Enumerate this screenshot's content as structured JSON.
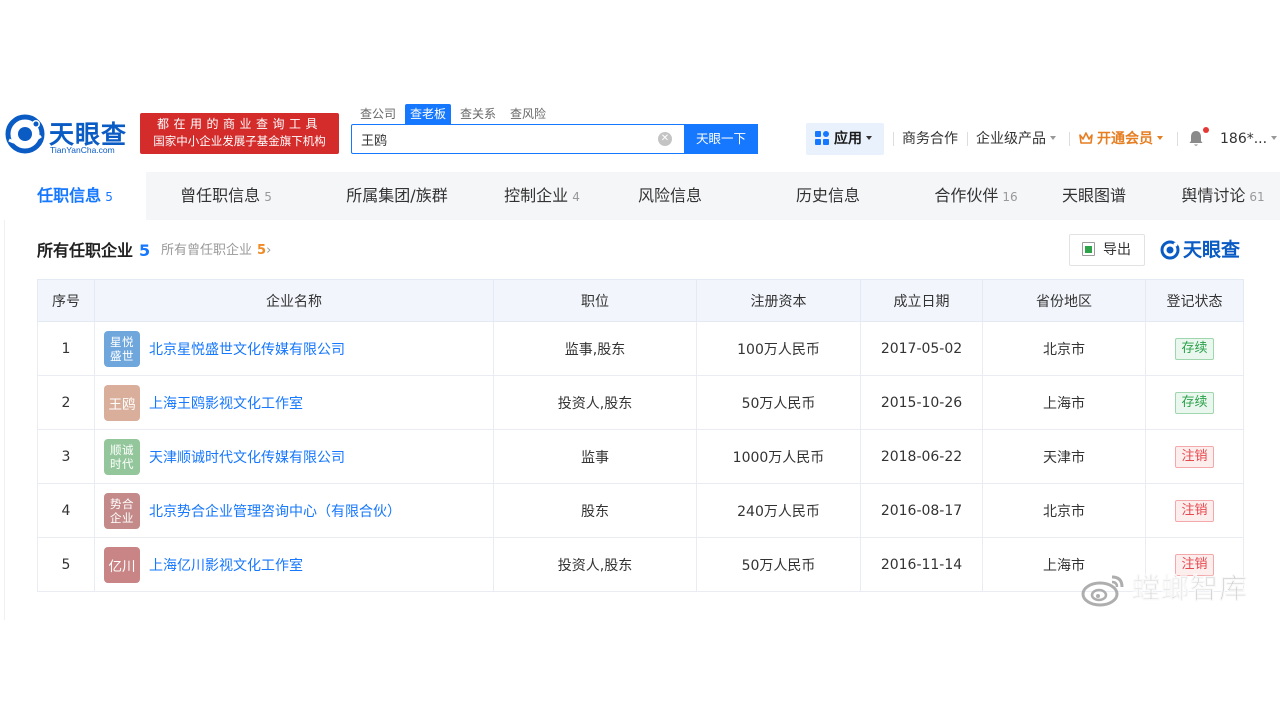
{
  "brand": {
    "name_cn": "天眼查",
    "name_en": "TianYanCha.com",
    "slogan_line1": "都在用的商业查询工具",
    "slogan_line2": "国家中小企业发展子基金旗下机构",
    "color": "#0a5bc4"
  },
  "search": {
    "tabs": [
      "查公司",
      "查老板",
      "查关系",
      "查风险"
    ],
    "active_tab": 1,
    "value": "王鸥",
    "button_label": "天眼一下"
  },
  "header_nav": {
    "app_label": "应用",
    "business_label": "商务合作",
    "enterprise_label": "企业级产品",
    "vip_label": "开通会员",
    "user_label": "186*..."
  },
  "tabs": [
    {
      "label": "任职信息",
      "count": "5"
    },
    {
      "label": "曾任职信息",
      "count": "5"
    },
    {
      "label": "所属集团/族群",
      "count": ""
    },
    {
      "label": "控制企业",
      "count": "4"
    },
    {
      "label": "风险信息",
      "count": ""
    },
    {
      "label": "历史信息",
      "count": ""
    },
    {
      "label": "合作伙伴",
      "count": "16"
    },
    {
      "label": "天眼图谱",
      "count": ""
    },
    {
      "label": "舆情讨论",
      "count": "61"
    }
  ],
  "section": {
    "title": "所有任职企业",
    "count": "5",
    "sub_label": "所有曾任职企业",
    "sub_count": "5",
    "sub_arrow": "›",
    "export_label": "导出",
    "brand_label": "天眼查"
  },
  "table": {
    "headers": [
      "序号",
      "企业名称",
      "职位",
      "注册资本",
      "成立日期",
      "省份地区",
      "登记状态"
    ],
    "rows": [
      {
        "index": "1",
        "logo_line1": "星悦",
        "logo_line2": "盛世",
        "logo_color": "#6fa7dd",
        "name": "北京星悦盛世文化传媒有限公司",
        "position": "监事,股东",
        "capital": "100万人民币",
        "date": "2017-05-02",
        "region": "北京市",
        "status": "存续",
        "status_type": "ok"
      },
      {
        "index": "2",
        "logo_line1": "王鸥",
        "logo_line2": "",
        "logo_color": "#d9ae9b",
        "name": "上海王鸥影视文化工作室",
        "position": "投资人,股东",
        "capital": "50万人民币",
        "date": "2015-10-26",
        "region": "上海市",
        "status": "存续",
        "status_type": "ok"
      },
      {
        "index": "3",
        "logo_line1": "顺诚",
        "logo_line2": "时代",
        "logo_color": "#93c79b",
        "name": "天津顺诚时代文化传媒有限公司",
        "position": "监事",
        "capital": "1000万人民币",
        "date": "2018-06-22",
        "region": "天津市",
        "status": "注销",
        "status_type": "bad"
      },
      {
        "index": "4",
        "logo_line1": "势合",
        "logo_line2": "企业",
        "logo_color": "#c48a8a",
        "name": "北京势合企业管理咨询中心（有限合伙）",
        "position": "股东",
        "capital": "240万人民币",
        "date": "2016-08-17",
        "region": "北京市",
        "status": "注销",
        "status_type": "bad"
      },
      {
        "index": "5",
        "logo_line1": "亿川",
        "logo_line2": "",
        "logo_color": "#c98585",
        "name": "上海亿川影视文化工作室",
        "position": "投资人,股东",
        "capital": "50万人民币",
        "date": "2016-11-14",
        "region": "上海市",
        "status": "注销",
        "status_type": "bad"
      }
    ]
  },
  "watermark": {
    "text": "螳螂智库"
  },
  "icons": [
    "tianyancha-logo-icon",
    "clear-icon",
    "app-grid-icon",
    "crown-icon",
    "bell-icon",
    "excel-icon",
    "weibo-icon"
  ]
}
